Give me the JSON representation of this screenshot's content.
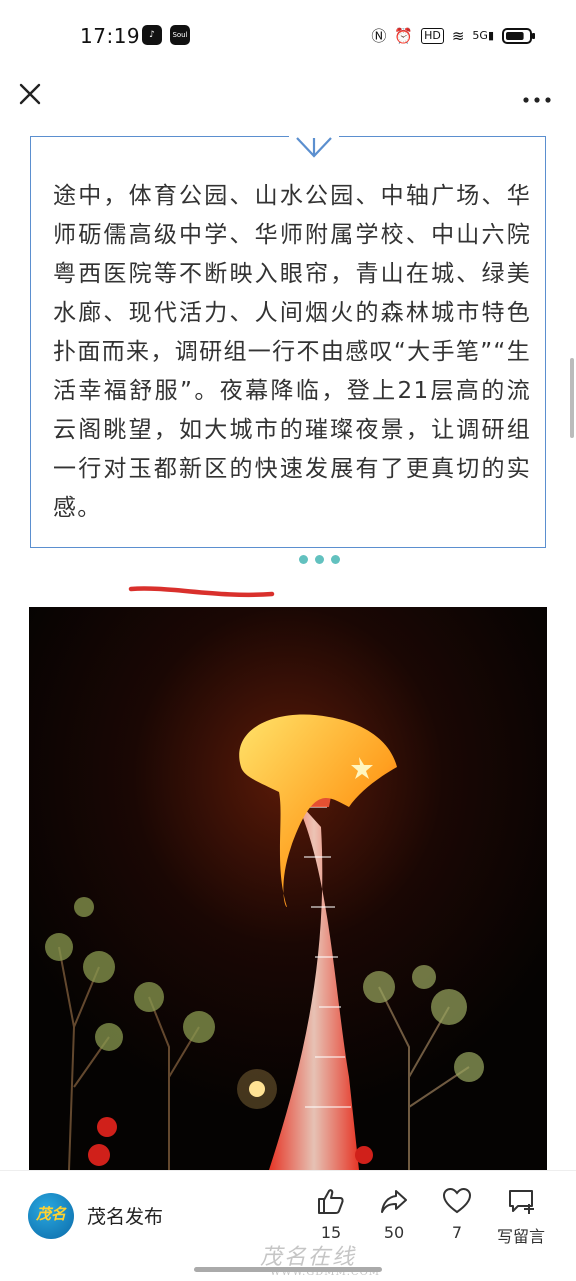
{
  "status_bar": {
    "time": "17:19",
    "app_icons": [
      "tiktok-icon",
      "soul-app-icon"
    ],
    "app_icon_glyphs": [
      "♪",
      "Soul"
    ],
    "system_icons": [
      {
        "name": "nfc-icon",
        "glyph": "Ⓝ"
      },
      {
        "name": "alarm-icon",
        "glyph": "⏰"
      },
      {
        "name": "hd-icon",
        "glyph": "HD"
      },
      {
        "name": "wifi-icon",
        "glyph": "≋"
      },
      {
        "name": "signal-5g-icon",
        "glyph": "5G▮"
      }
    ],
    "battery_level": 0.8
  },
  "nav": {
    "close_icon": "close-icon",
    "more_icon": "more-icon"
  },
  "article": {
    "text_box": {
      "paragraph": "途中，体育公园、山水公园、中轴广场、华师砺儒高级中学、华师附属学校、中山六院粤西医院等不断映入眼帘，青山在城、绿美水廊、现代活力、人间烟火的森林城市特色扑面而来，调研组一行不由感叹“大手笔”“生活幸福舒服”。夜幕降临，登上21层高的流云阁眺望，如大城市的璀璨夜景，让调研组一行对玉都新区的快速发展有了更真切的实感。",
      "accent_color": "#5b8fcf",
      "dot_color": "#62c1bf",
      "underline_color": "#d9302c"
    },
    "photo": {
      "subject": "night view of the Liuyun Pavilion tower lit in red and yellow"
    }
  },
  "bottom_bar": {
    "account_logo_text": "茂名",
    "account_name": "茂名发布",
    "actions": {
      "like": {
        "icon": "thumbs-up-icon",
        "count": "15"
      },
      "share": {
        "icon": "share-icon",
        "count": "50"
      },
      "favorite": {
        "icon": "heart-icon",
        "count": "7"
      },
      "comment": {
        "icon": "comment-add-icon",
        "label": "写留言"
      }
    },
    "watermark": "茂名在线",
    "watermark_sub": "WWW.GDMM.COM"
  }
}
